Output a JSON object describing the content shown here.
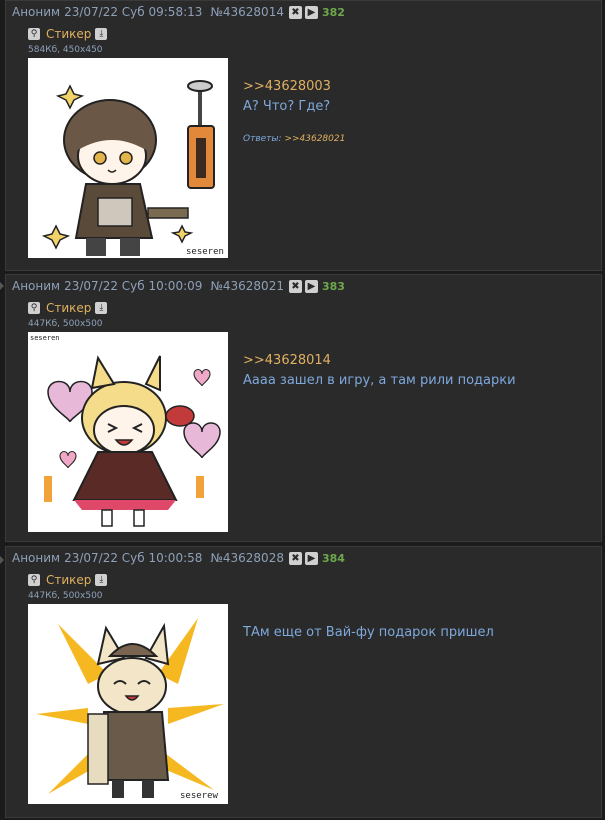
{
  "posts": [
    {
      "author": "Аноним",
      "date": "23/07/22 Суб 09:58:13",
      "id": "№43628014",
      "index": "382",
      "file_label": "Стикер",
      "file_meta": "584Кб, 450x450",
      "reply_to": ">>43628003",
      "text": "А? Что? Где?",
      "answers_label": "Ответы:",
      "answers_link": ">>43628021",
      "watermark": "seseren"
    },
    {
      "author": "Аноним",
      "date": "23/07/22 Суб 10:00:09",
      "id": "№43628021",
      "index": "383",
      "file_label": "Стикер",
      "file_meta": "447Кб, 500x500",
      "reply_to": ">>43628014",
      "text": "Аааа зашел в игру, а там рили подарки",
      "watermark": "seseren"
    },
    {
      "author": "Аноним",
      "date": "23/07/22 Суб 10:00:58",
      "id": "№43628028",
      "index": "384",
      "file_label": "Стикер",
      "file_meta": "447Кб, 500x500",
      "text": "ТАм еще от Вай-фу подарок пришел",
      "watermark": "seserew"
    }
  ],
  "icons": {
    "hide": "✖",
    "play": "▶",
    "magnifier": "🔍",
    "download": "⤓"
  },
  "colors": {
    "background": "#1b1b1b",
    "post_bg": "#2a2a2a",
    "header_text": "#8ea0b8",
    "post_number": "#6ea84b",
    "link": "#e0b060",
    "message_text": "#7ea8dc"
  }
}
